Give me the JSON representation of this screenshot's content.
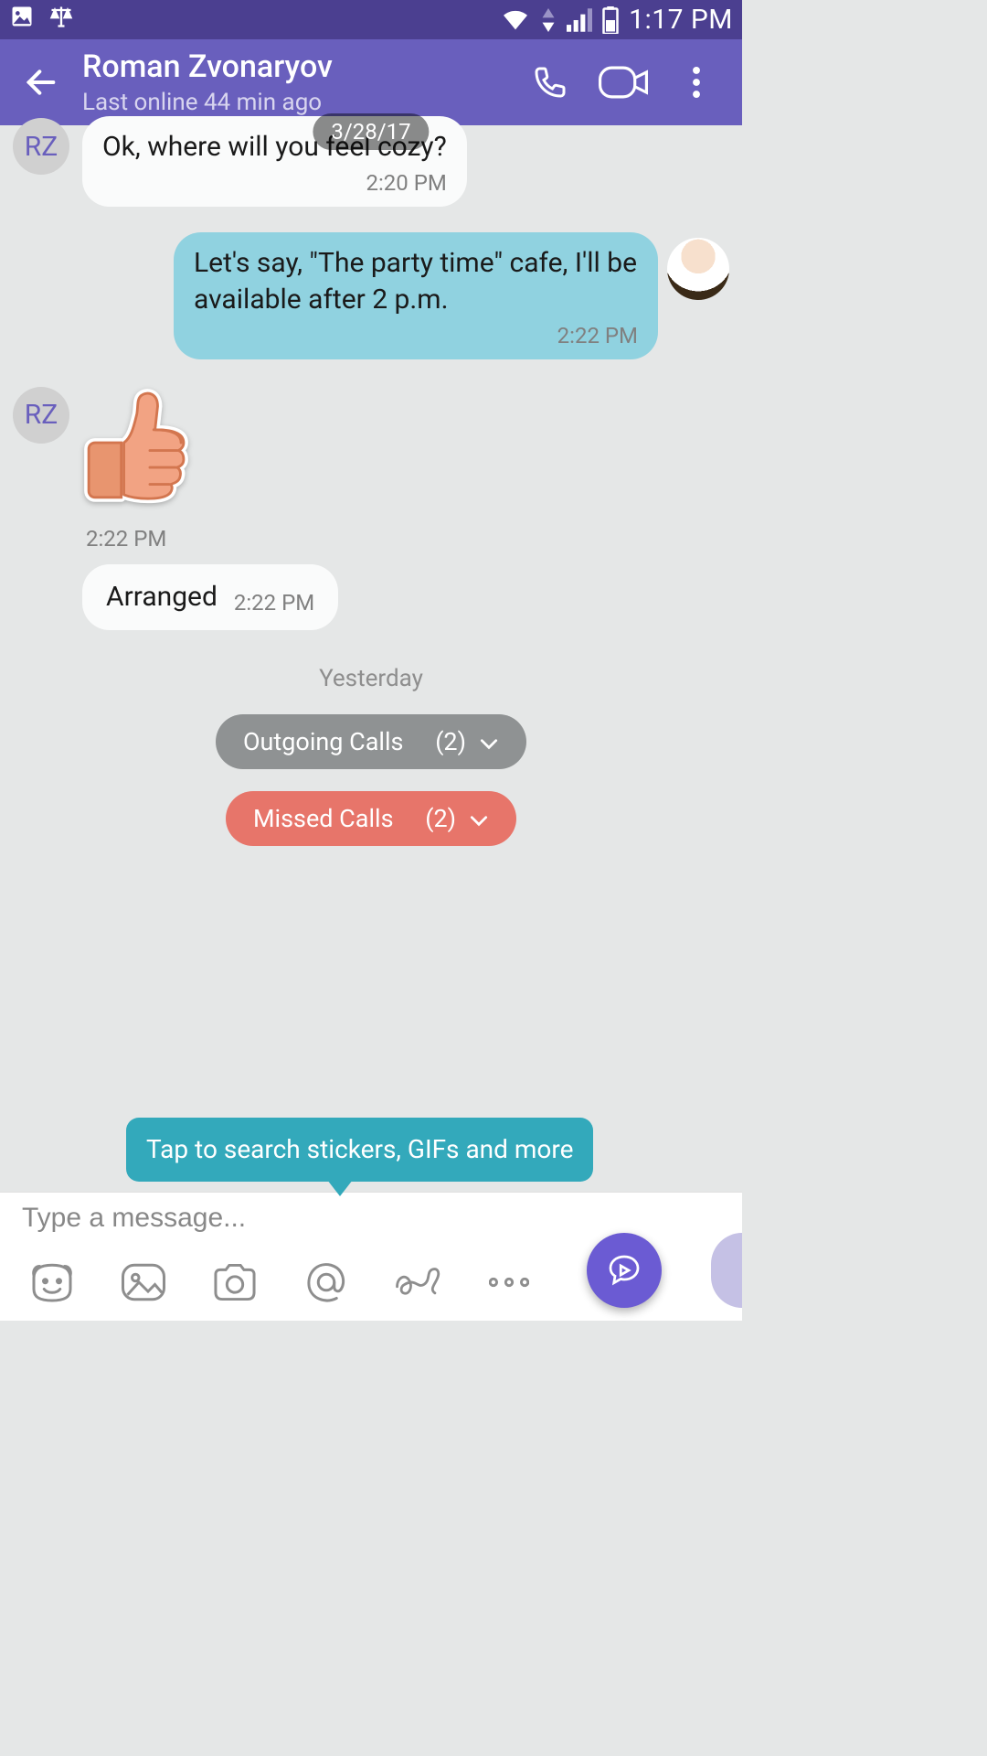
{
  "status_bar": {
    "time": "1:17 PM"
  },
  "header": {
    "name": "Roman Zvonaryov",
    "last_seen": "Last online 44 min ago"
  },
  "chat": {
    "date_pill": "3/28/17",
    "contact_initials": "RZ",
    "msg1": {
      "text": "Ok, where will you feel cozy?",
      "time": "2:20 PM"
    },
    "msg2": {
      "text": "Let's say, \"The party time\" cafe, I'll be available after 2 p.m.",
      "time": "2:22 PM"
    },
    "sticker_name": "thumbs-up-sticker",
    "sticker_time": "2:22 PM",
    "msg3": {
      "text": "Arranged",
      "time": "2:22 PM"
    },
    "divider": "Yesterday",
    "outgoing_calls": {
      "label": "Outgoing Calls",
      "count": "(2)"
    },
    "missed_calls": {
      "label": "Missed Calls",
      "count": "(2)"
    }
  },
  "hint": "Tap to search stickers, GIFs and more",
  "input": {
    "placeholder": "Type a message..."
  }
}
